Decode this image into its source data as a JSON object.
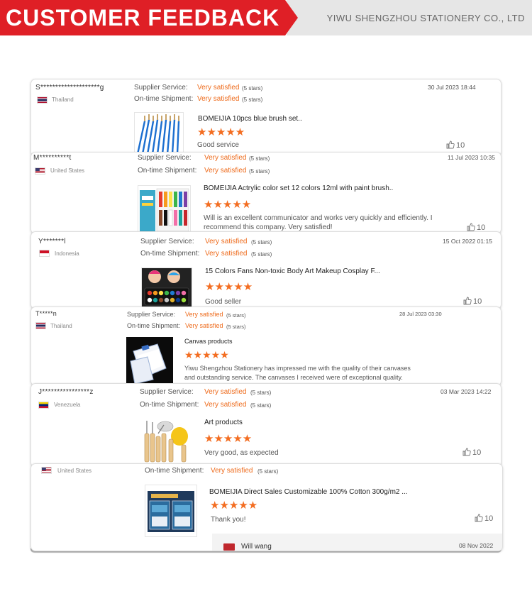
{
  "header": {
    "title": "CUSTOMER FEEDBACK",
    "company": "YIWU SHENGZHOU STATIONERY CO., LTD",
    "brand_color": "#df1f26"
  },
  "labels": {
    "supplier_service": "Supplier Service:",
    "ontime_shipment": "On-time Shipment:",
    "very_satisfied": "Very satisfied",
    "five_stars": "(5 stars)",
    "star_glyphs": "★★★★★"
  },
  "accent_color": "#f36d21",
  "reviews": [
    {
      "user": "S********************g",
      "country": "Thailand",
      "flag": "thailand-flag",
      "date": "30 Jul 2023 18:44",
      "product": "BOMEIJIA 10pcs blue brush set..",
      "rating": 5,
      "comment": "Good service",
      "likes": "10",
      "image": "blue-brushes"
    },
    {
      "user": "M**********t",
      "country": "United States",
      "flag": "usa-flag",
      "date": "11 Jul 2023 10:35",
      "product": "BOMEIJIA  Actrylic color set 12 colors 12ml with paint brush..",
      "rating": 5,
      "comment": "Will is an excellent communicator and works very quickly and efficiently. I recommend this company. Very satisfied!",
      "likes": "10",
      "image": "acrylic-paint-set"
    },
    {
      "user": "Y*******l",
      "country": "Indonesia",
      "flag": "indonesia-flag",
      "date": "15 Oct 2022 01:15",
      "product": "15 Colors Fans Non-toxic Body Art Makeup Cosplay F...",
      "rating": 5,
      "comment": "Good seller",
      "likes": "10",
      "image": "face-paint-palette"
    },
    {
      "user": "T*****n",
      "country": "Thailand",
      "flag": "thailand-flag",
      "date": "28 Jul 2023 03:30",
      "product": "Canvas products",
      "rating": 5,
      "comment": "Yiwu Shengzhou Stationery has impressed me with the quality of their canvases and outstanding service. The canvases I received were of exceptional quality. Working",
      "likes": "",
      "image": "canvas-boards"
    },
    {
      "user": "J****************z",
      "country": "Venezuela",
      "flag": "venezuela-flag",
      "date": "03 Mar 2023 14:22",
      "product": "Art products",
      "rating": 5,
      "comment": "Very good, as expected",
      "likes": "10",
      "image": "clay-tools"
    },
    {
      "user": "",
      "country": "United States",
      "flag": "usa-flag",
      "date": "",
      "product": "BOMEIJIA Direct Sales Customizable 100% Cotton 300g/m2 ...",
      "rating": 5,
      "comment": "Thank you!",
      "likes": "10",
      "image": "watercolor-pads",
      "reply": {
        "name": "Will wang",
        "date": "08 Nov 2022"
      }
    }
  ]
}
